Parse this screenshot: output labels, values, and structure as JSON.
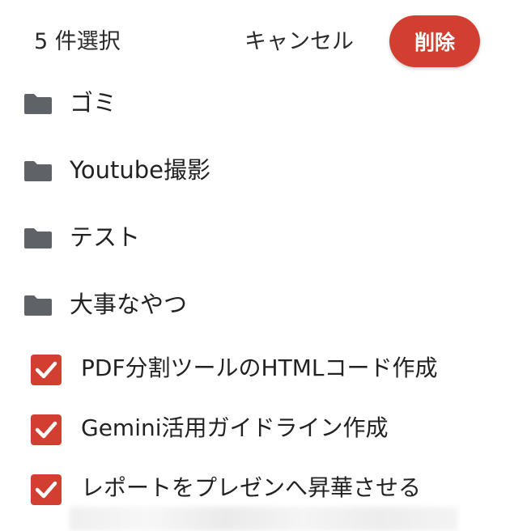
{
  "header": {
    "selected_count": "5 件選択",
    "cancel_label": "キャンセル",
    "delete_label": "削除"
  },
  "colors": {
    "accent": "#d23f31",
    "folder_icon": "#5f6368",
    "checkbox": "#d23f31",
    "text": "#222222"
  },
  "folders": [
    {
      "label": "ゴミ",
      "icon": "folder-icon"
    },
    {
      "label": "Youtube撮影",
      "icon": "folder-icon"
    },
    {
      "label": "テスト",
      "icon": "folder-icon"
    },
    {
      "label": "大事なやつ",
      "icon": "folder-icon"
    }
  ],
  "files": [
    {
      "label": "PDF分割ツールのHTMLコード作成",
      "checked": true
    },
    {
      "label": "Gemini活用ガイドライン作成",
      "checked": true
    },
    {
      "label": "レポートをプレゼンへ昇華させる",
      "checked": true
    }
  ]
}
